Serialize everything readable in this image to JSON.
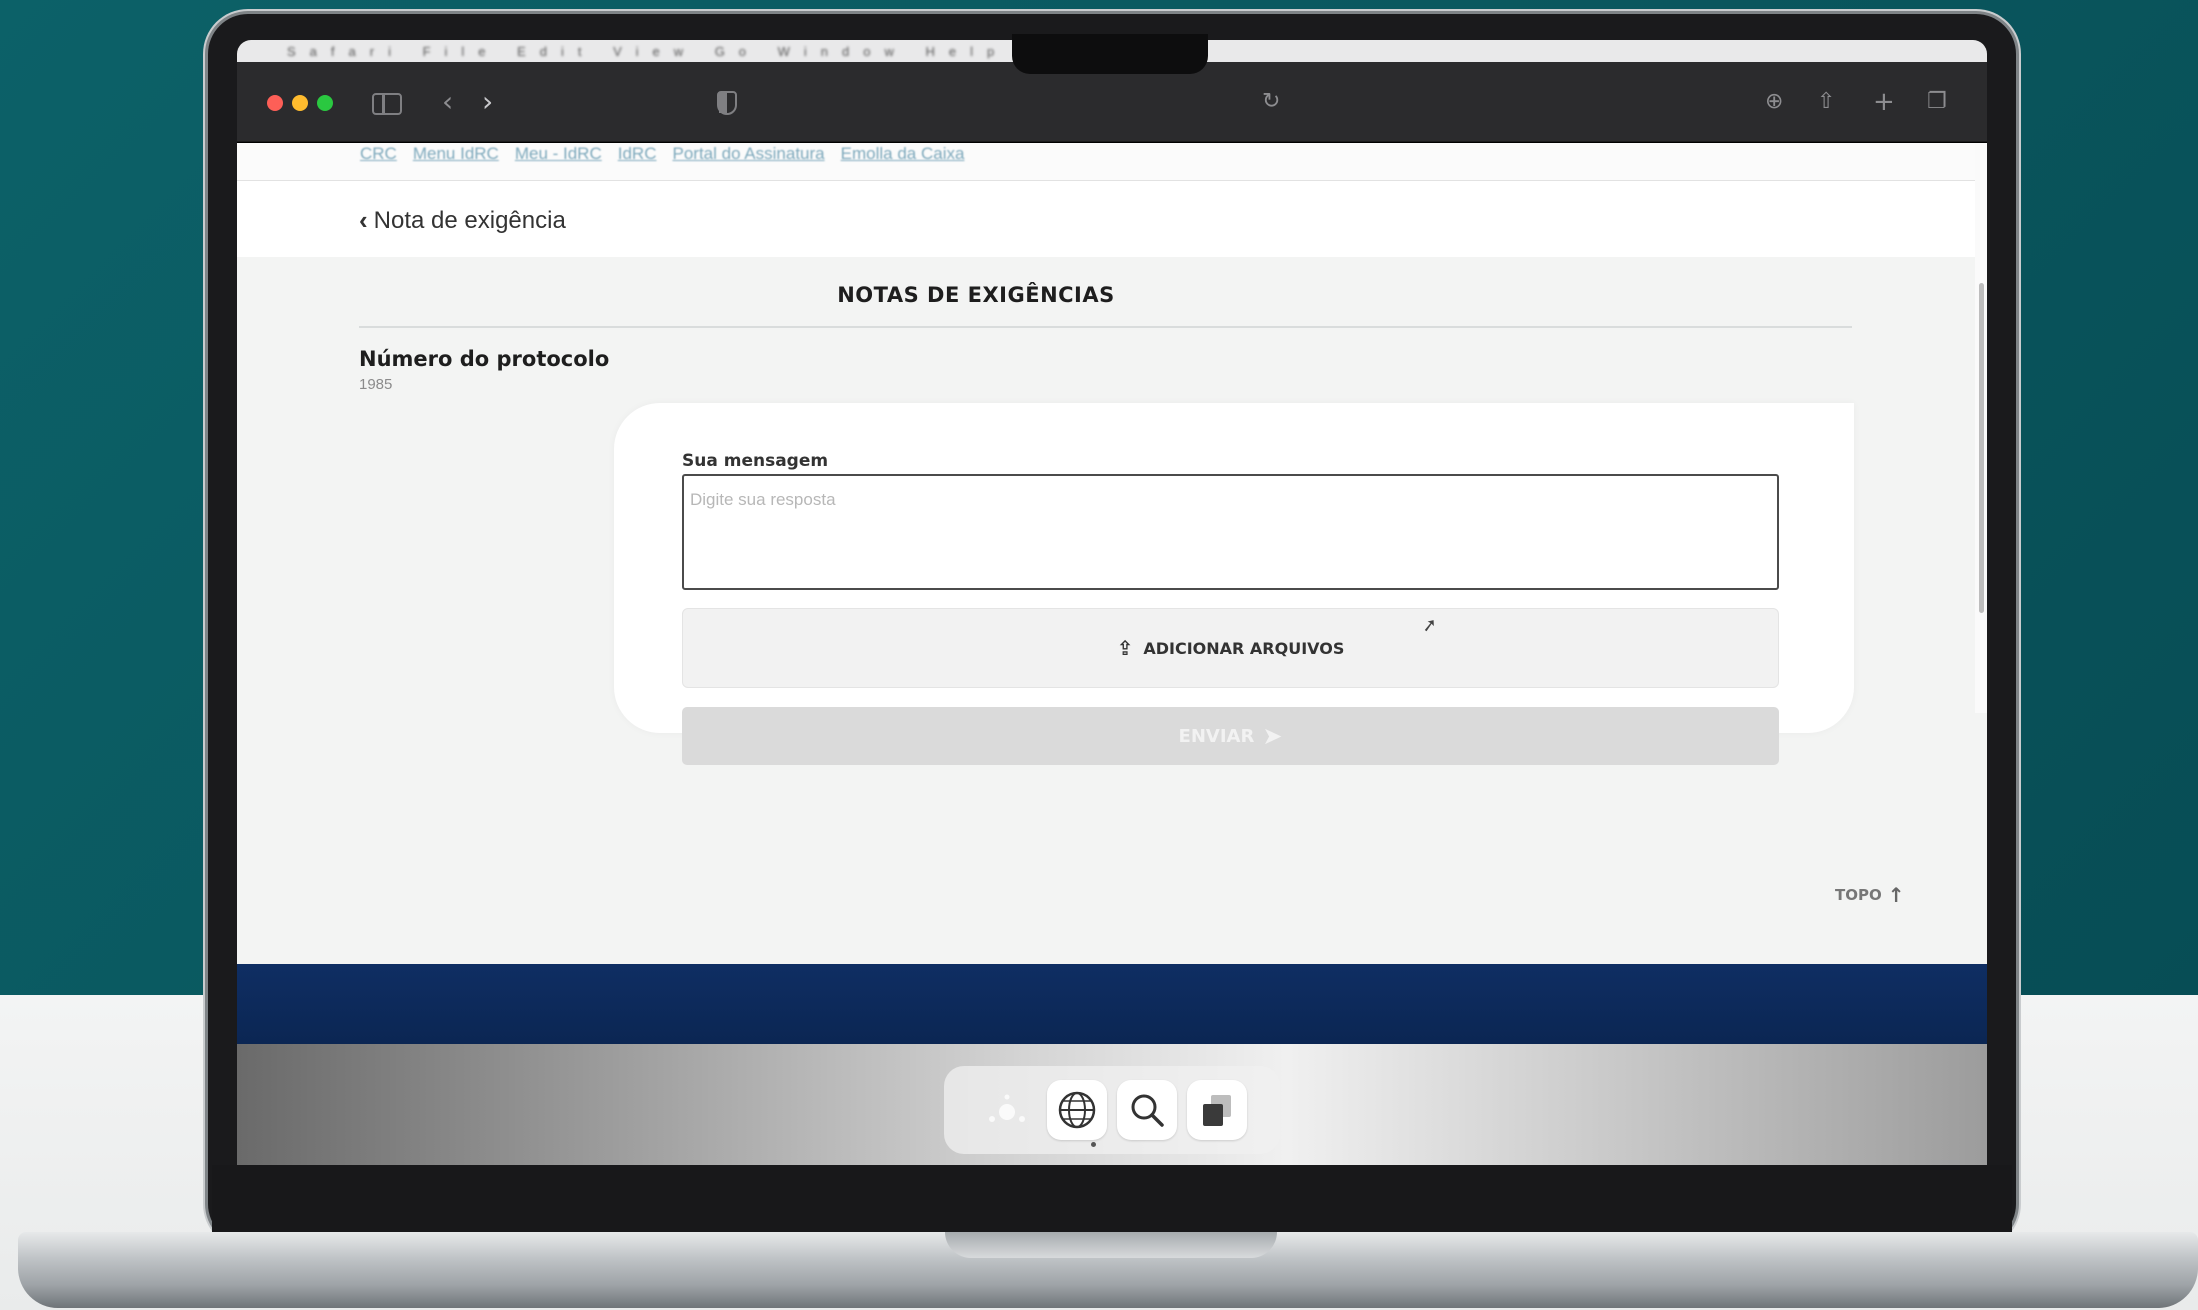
{
  "page": {
    "links": [
      "CRC",
      "Menu IdRC",
      "Meu - IdRC",
      "IdRC",
      "Portal do Assinatura",
      "Emolla da Caixa"
    ],
    "back_label": "Nota de exigência",
    "title": "NOTAS DE EXIGÊNCIAS",
    "protocol": {
      "label": "Número do protocolo",
      "value": "1985"
    },
    "form": {
      "message_label": "Sua mensagem",
      "message_placeholder": "Digite sua resposta",
      "message_value": "",
      "upload_label": "ADICIONAR ARQUIVOS",
      "send_label": "ENVIAR"
    },
    "top_link": "TOPO"
  },
  "browser": {
    "menubar": "Safari File Edit View Go Window Help"
  },
  "icons": {
    "back": "chevron-left-icon",
    "upload": "upload-icon",
    "send": "send-arrow-icon",
    "top": "arrow-up-icon",
    "dock": [
      "launchpad-icon",
      "globe-icon",
      "search-icon",
      "preview-icon"
    ]
  },
  "colors": {
    "background_teal": "#0b5d63",
    "footer_navy": "#0f2e63",
    "link_blue": "#7ea9bc",
    "send_disabled": "#dadada"
  }
}
